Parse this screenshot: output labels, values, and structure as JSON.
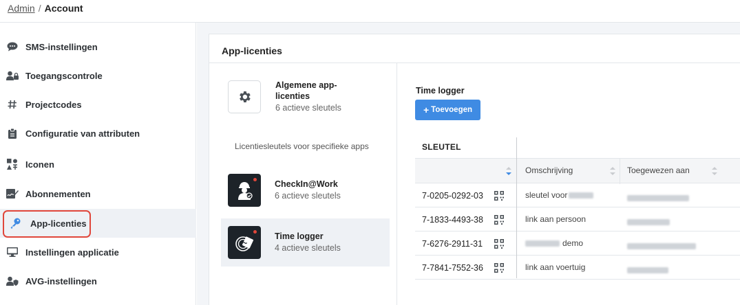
{
  "breadcrumb": {
    "link": "Admin",
    "separator": "/",
    "current": "Account"
  },
  "sidebar": {
    "items": [
      {
        "label": "SMS-instellingen",
        "icon": "chat-bubble-icon"
      },
      {
        "label": "Toegangscontrole",
        "icon": "user-lock-icon"
      },
      {
        "label": "Projectcodes",
        "icon": "hash-icon"
      },
      {
        "label": "Configuratie van attributen",
        "icon": "clipboard-icon"
      },
      {
        "label": "Iconen",
        "icon": "icons-grid-icon"
      },
      {
        "label": "Abonnementen",
        "icon": "signature-icon"
      },
      {
        "label": "App-licenties",
        "icon": "key-icon",
        "active": true
      },
      {
        "label": "Instellingen applicatie",
        "icon": "monitor-icon"
      },
      {
        "label": "AVG-instellingen",
        "icon": "user-shield-icon"
      }
    ]
  },
  "card": {
    "title": "App-licenties",
    "general": {
      "name": "Algemene app-licenties",
      "sub": "6 actieve sleutels",
      "icon": "gear-icon"
    },
    "specific_label": "Licentiesleutels voor specifieke apps",
    "apps": [
      {
        "name": "CheckIn@Work",
        "sub": "6 actieve sleutels",
        "icon": "worker-icon"
      },
      {
        "name": "Time logger",
        "sub": "4 actieve sleutels",
        "icon": "time-logger-icon",
        "selected": true
      }
    ]
  },
  "detail": {
    "title": "Time logger",
    "add_button": "Toevoegen",
    "table": {
      "header": "SLEUTEL",
      "columns": [
        "Omschrijving",
        "Toegewezen aan"
      ],
      "rows": [
        {
          "key": "7-0205-0292-03",
          "desc": "sleutel voor"
        },
        {
          "key": "7-1833-4493-38",
          "desc": "link aan persoon"
        },
        {
          "key": "7-6276-2911-31",
          "desc": "demo"
        },
        {
          "key": "7-7841-7552-36",
          "desc": "link aan voertuig"
        }
      ]
    }
  },
  "colors": {
    "accent": "#3f8be3",
    "highlight": "#e0463a",
    "active_bg": "#eef1f5"
  }
}
